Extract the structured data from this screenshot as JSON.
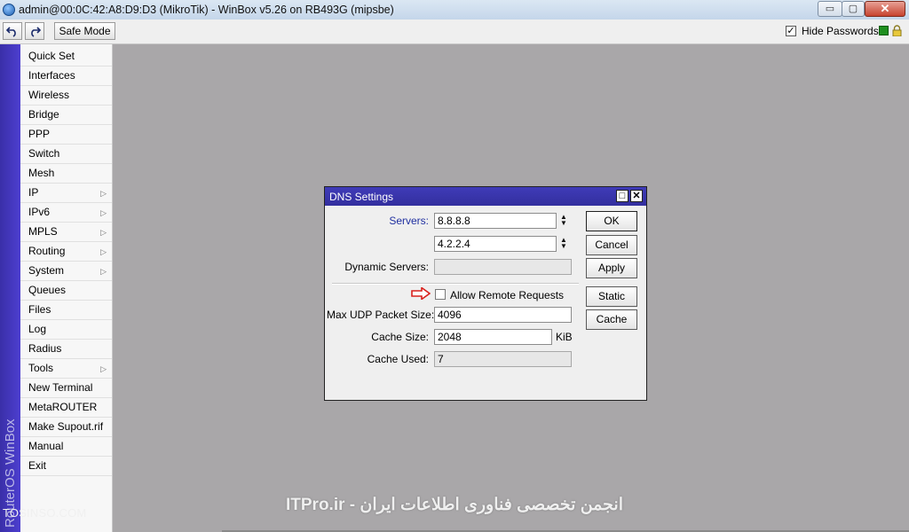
{
  "window": {
    "title": "admin@00:0C:42:A8:D9:D3 (MikroTik) - WinBox v5.26 on RB493G (mipsbe)",
    "controls": {
      "minimize": "▭",
      "maximize": "▢",
      "close": "✕"
    }
  },
  "toolbar": {
    "undo_icon": "undo-icon",
    "redo_icon": "redo-icon",
    "safe_mode_label": "Safe Mode",
    "hide_passwords_label": "Hide Passwords",
    "hide_passwords_checked": true
  },
  "sidebar": {
    "brand_text": "RouterOS WinBox",
    "items": [
      {
        "label": "Quick Set",
        "submenu": false
      },
      {
        "label": "Interfaces",
        "submenu": false
      },
      {
        "label": "Wireless",
        "submenu": false
      },
      {
        "label": "Bridge",
        "submenu": false
      },
      {
        "label": "PPP",
        "submenu": false
      },
      {
        "label": "Switch",
        "submenu": false
      },
      {
        "label": "Mesh",
        "submenu": false
      },
      {
        "label": "IP",
        "submenu": true
      },
      {
        "label": "IPv6",
        "submenu": true
      },
      {
        "label": "MPLS",
        "submenu": true
      },
      {
        "label": "Routing",
        "submenu": true
      },
      {
        "label": "System",
        "submenu": true
      },
      {
        "label": "Queues",
        "submenu": false
      },
      {
        "label": "Files",
        "submenu": false
      },
      {
        "label": "Log",
        "submenu": false
      },
      {
        "label": "Radius",
        "submenu": false
      },
      {
        "label": "Tools",
        "submenu": true
      },
      {
        "label": "New Terminal",
        "submenu": false
      },
      {
        "label": "MetaROUTER",
        "submenu": false
      },
      {
        "label": "Make Supout.rif",
        "submenu": false
      },
      {
        "label": "Manual",
        "submenu": false
      },
      {
        "label": "Exit",
        "submenu": false
      }
    ]
  },
  "dns_dialog": {
    "title": "DNS Settings",
    "labels": {
      "servers": "Servers:",
      "dynamic_servers": "Dynamic Servers:",
      "allow_remote": "Allow Remote Requests",
      "max_udp": "Max UDP Packet Size:",
      "cache_size": "Cache Size:",
      "cache_size_unit": "KiB",
      "cache_used": "Cache Used:"
    },
    "values": {
      "server_1": "8.8.8.8",
      "server_2": "4.2.2.4",
      "dynamic_servers": "",
      "allow_remote_checked": false,
      "max_udp": "4096",
      "cache_size": "2048",
      "cache_used": "7"
    },
    "buttons": {
      "ok": "OK",
      "cancel": "Cancel",
      "apply": "Apply",
      "static": "Static",
      "cache": "Cache"
    }
  },
  "watermarks": {
    "left": "TOSINSO.COM",
    "center": "ITPro.ir - انجمن تخصصی فناوری اطلاعات ایران"
  },
  "colors": {
    "workspace": "#a9a7a9",
    "dialog_title": "#3a36b0",
    "annotation_arrow": "#d9201c",
    "status_indicator": "#1f8f1f"
  }
}
